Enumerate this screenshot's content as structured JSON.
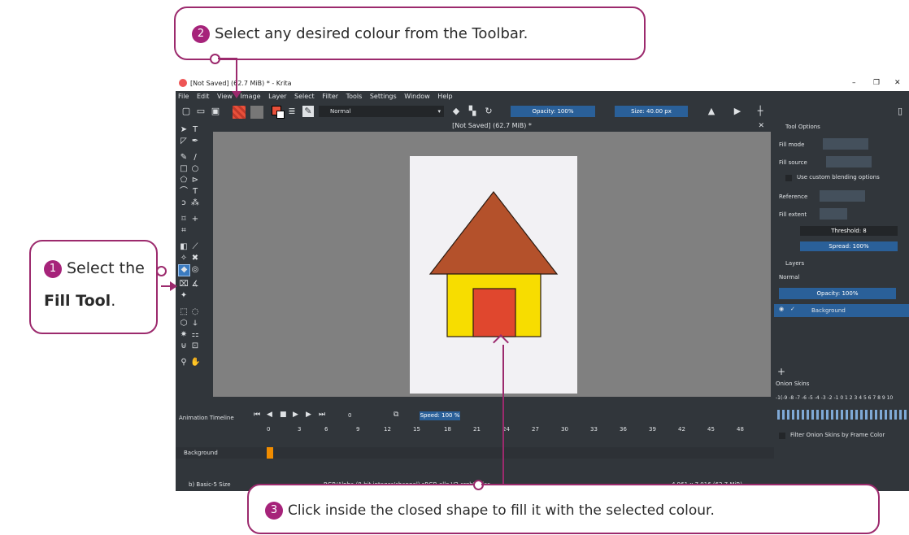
{
  "callouts": {
    "step1": {
      "number": "1",
      "line1": "Select the",
      "line2": "Fill Tool",
      "line2_suffix": "."
    },
    "step2": {
      "number": "2",
      "text": "Select any desired colour from the Toolbar."
    },
    "step3": {
      "number": "3",
      "text": "Click inside the closed shape to fill it with the selected colour."
    }
  },
  "window": {
    "title": "[Not Saved]  (62.7 MiB) * - Krita",
    "controls": {
      "minimize": "–",
      "maximize": "❐",
      "close": "✕"
    }
  },
  "menu": [
    "File",
    "Edit",
    "View",
    "Image",
    "Layer",
    "Select",
    "Filter",
    "Tools",
    "Settings",
    "Window",
    "Help"
  ],
  "toolbar": {
    "blend_mode": "Normal",
    "opacity": "Opacity: 100%",
    "size": "Size: 40.00 px"
  },
  "document": {
    "tab_title": "[Not Saved]  (62.7 MiB) *"
  },
  "tool_options": {
    "header": "Tool Options",
    "fill_mode": "Fill mode",
    "fill_source": "Fill source",
    "custom_blending": "Use custom blending options",
    "reference": "Reference",
    "fill_extent": "Fill extent",
    "threshold": "Threshold: 8",
    "spread": "Spread: 100%"
  },
  "layers": {
    "header": "Layers",
    "blend_mode": "Normal",
    "opacity": "Opacity: 100%",
    "layer_name": "Background"
  },
  "onion": {
    "header": "Onion Skins",
    "frames": "-1(-9 -8 -7 -6 -5 -4 -3 -2 -1  0  1 2 3 4 5 6 7 8 9 10",
    "filter_label": "Filter Onion Skins by Frame Color"
  },
  "timeline": {
    "header": "Animation Timeline",
    "frame": "0",
    "speed": "Speed: 100 %",
    "ruler": [
      "0",
      "3",
      "6",
      "9",
      "12",
      "15",
      "18",
      "21",
      "24",
      "27",
      "30",
      "33",
      "36",
      "39",
      "42",
      "45",
      "48"
    ],
    "layer": "Background"
  },
  "status": {
    "brush": "b) Basic-5 Size",
    "color_info": "RGB/Alpha (8-bit integer/channel)  sRGB-elle-V2-srgbtrc.icc",
    "dimensions": "4,961 x 7,016 (62.7 MiB)"
  },
  "colors": {
    "accent": "#9c2a6d",
    "badge": "#a6237a",
    "roof": "#b4512b",
    "wall": "#f7dd00",
    "door": "#e0472e",
    "krita_dark": "#31363b",
    "krita_blue": "#2a6099"
  }
}
